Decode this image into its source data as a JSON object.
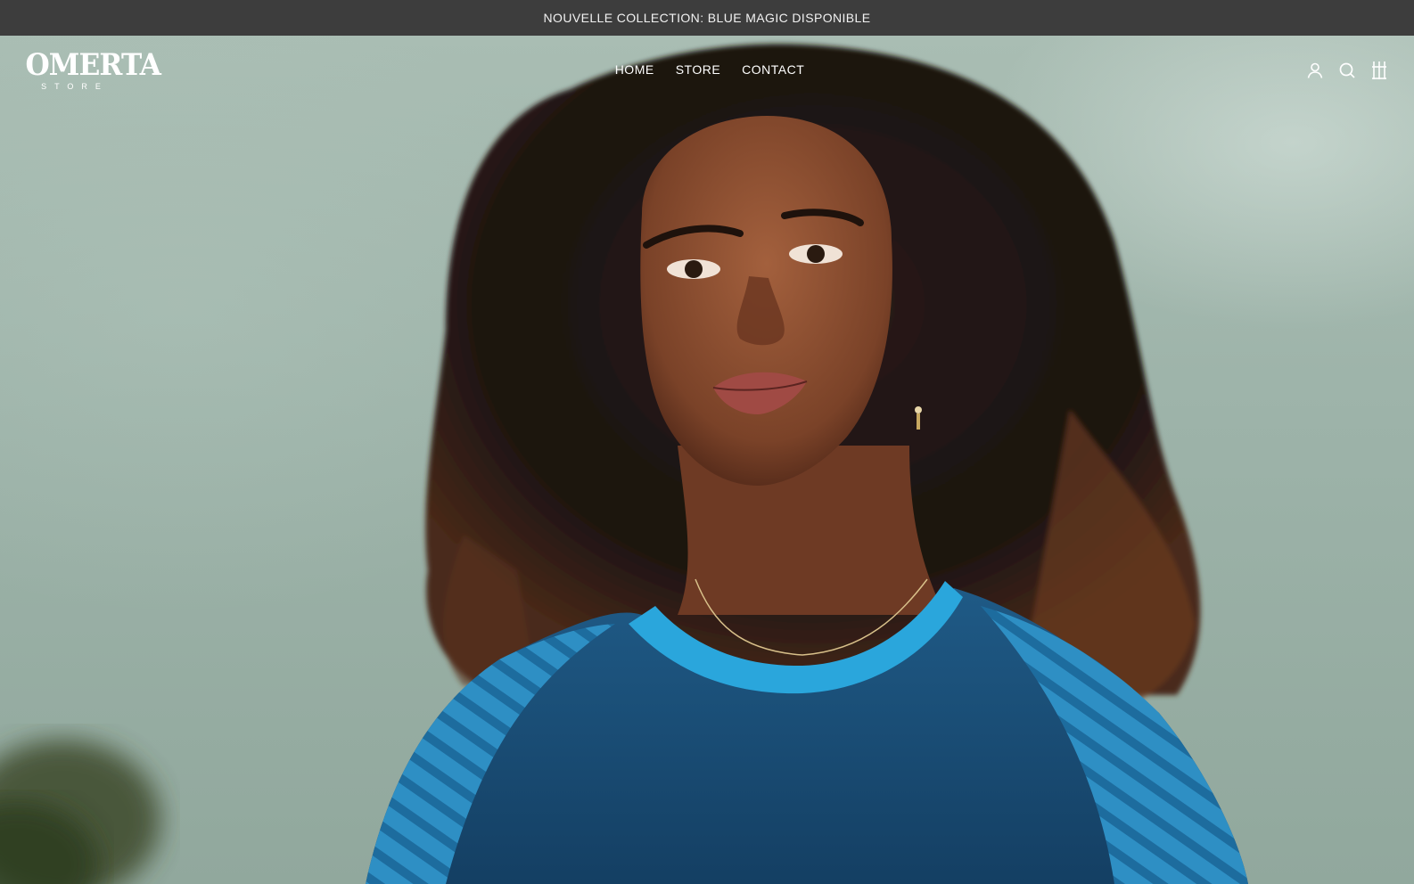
{
  "announcement": {
    "text": "NOUVELLE COLLECTION: BLUE MAGIC DISPONIBLE",
    "background": "#3d3d3d"
  },
  "header": {
    "logo": {
      "main": "OMERTA",
      "sub": "STORE"
    },
    "nav": [
      {
        "label": "HOME"
      },
      {
        "label": "STORE"
      },
      {
        "label": "CONTACT"
      }
    ],
    "icons": [
      "account-icon",
      "search-icon",
      "cart-icon"
    ]
  },
  "hero": {
    "subject": "hero-photo-model-blue-jersey"
  },
  "colors": {
    "sky": "#a3b9ae",
    "jersey": "#1b4f7a",
    "jersey_accent": "#2a9fd6",
    "hair": "#1a1412",
    "skin": "#8a4e32"
  }
}
